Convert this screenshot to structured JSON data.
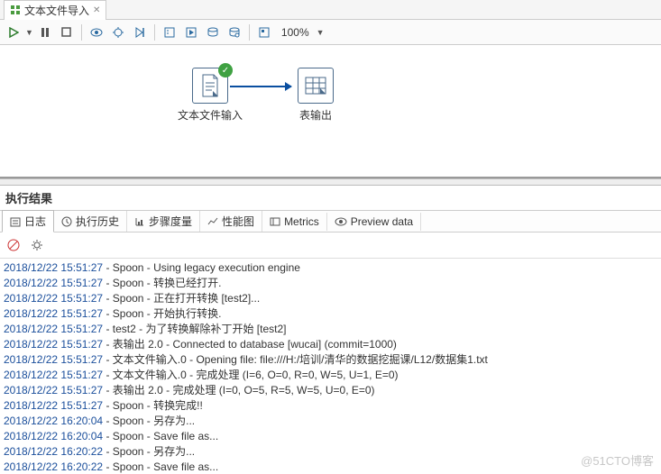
{
  "tab": {
    "title": "文本文件导入"
  },
  "toolbar": {
    "zoom": "100%"
  },
  "canvas": {
    "node1": {
      "label": "文本文件输入"
    },
    "node2": {
      "label": "表输出"
    }
  },
  "results": {
    "title": "执行结果",
    "tabs": {
      "log": "日志",
      "history": "执行历史",
      "step": "步骤度量",
      "perf": "性能图",
      "metrics": "Metrics",
      "preview": "Preview data"
    }
  },
  "log": [
    {
      "ts": "2018/12/22 15:51:27",
      "msg": "Spoon - Using legacy execution engine"
    },
    {
      "ts": "2018/12/22 15:51:27",
      "msg": "Spoon - 转换已经打开."
    },
    {
      "ts": "2018/12/22 15:51:27",
      "msg": "Spoon - 正在打开转换 [test2]..."
    },
    {
      "ts": "2018/12/22 15:51:27",
      "msg": "Spoon - 开始执行转换."
    },
    {
      "ts": "2018/12/22 15:51:27",
      "msg": "test2 - 为了转换解除补丁开始  [test2]"
    },
    {
      "ts": "2018/12/22 15:51:27",
      "msg": "表输出 2.0 - Connected to database [wucai] (commit=1000)"
    },
    {
      "ts": "2018/12/22 15:51:27",
      "msg": "文本文件输入.0 - Opening file: file:///H:/培训/清华的数据挖掘课/L12/数据集1.txt"
    },
    {
      "ts": "2018/12/22 15:51:27",
      "msg": "文本文件输入.0 - 完成处理 (I=6, O=0, R=0, W=5, U=1, E=0)"
    },
    {
      "ts": "2018/12/22 15:51:27",
      "msg": "表输出 2.0 - 完成处理 (I=0, O=5, R=5, W=5, U=0, E=0)"
    },
    {
      "ts": "2018/12/22 15:51:27",
      "msg": "Spoon - 转换完成!!"
    },
    {
      "ts": "2018/12/22 16:20:04",
      "msg": "Spoon - 另存为..."
    },
    {
      "ts": "2018/12/22 16:20:04",
      "msg": "Spoon - Save file as..."
    },
    {
      "ts": "2018/12/22 16:20:22",
      "msg": "Spoon - 另存为..."
    },
    {
      "ts": "2018/12/22 16:20:22",
      "msg": "Spoon - Save file as..."
    }
  ],
  "watermark": "@51CTO博客"
}
